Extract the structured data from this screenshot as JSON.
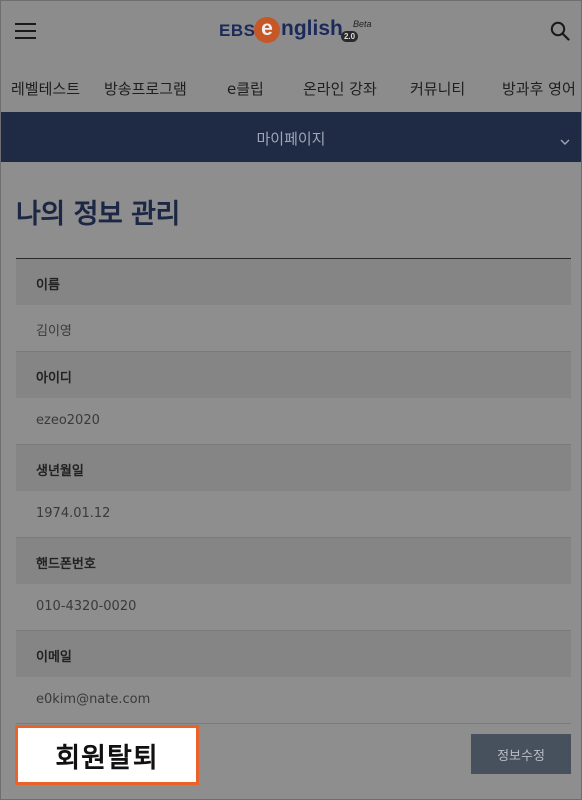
{
  "header": {
    "menu_icon": "hamburger-menu-icon",
    "logo": {
      "ebs": "EBS",
      "e": "e",
      "word": "nglish",
      "badge": "2.0",
      "beta": "Beta"
    },
    "search_icon": "magnifier-search-icon"
  },
  "nav": {
    "items": [
      "레벨테스트",
      "방송프로그램",
      "e클립",
      "온라인 강좌",
      "커뮤니티",
      "방과후 영어"
    ]
  },
  "mypage_bar": {
    "label": "마이페이지",
    "chevron_icon": "chevron-down-icon"
  },
  "page": {
    "title": "나의 정보 관리"
  },
  "fields": [
    {
      "label": "이름",
      "value": "김이영"
    },
    {
      "label": "아이디",
      "value": "ezeo2020"
    },
    {
      "label": "생년월일",
      "value": "1974.01.12"
    },
    {
      "label": "핸드폰번호",
      "value": "010-4320-0020"
    },
    {
      "label": "이메일",
      "value": "e0kim@nate.com"
    }
  ],
  "actions": {
    "withdraw": "회원탈퇴",
    "edit": "정보수정"
  },
  "colors": {
    "accent_border": "#e8622a",
    "nav_bar": "#1f2a44",
    "title": "#1b2745",
    "logo_orange": "#c55826"
  }
}
